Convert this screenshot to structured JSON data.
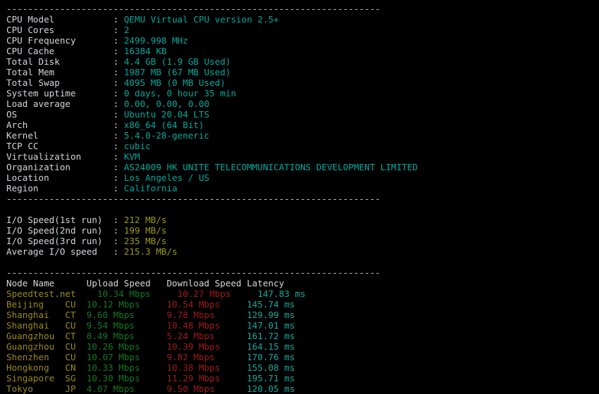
{
  "terminal": {
    "separator": "----------------------------------------------------------------------",
    "colors": {
      "background": "#000000",
      "label": "#d4d7da",
      "value_cyan": "#00a99d",
      "value_yellow": "#9a9a1f",
      "node_name": "#9a8a12",
      "upload": "#117a23",
      "download": "#a11a1a",
      "latency": "#14a89a",
      "separator": "#c9cdd1"
    }
  },
  "system_info": {
    "rows": [
      {
        "label": "CPU Model",
        "value": "QEMU Virtual CPU version 2.5+"
      },
      {
        "label": "CPU Cores",
        "value": "2"
      },
      {
        "label": "CPU Frequency",
        "value": "2499.998 MHz"
      },
      {
        "label": "CPU Cache",
        "value": "16384 KB"
      },
      {
        "label": "Total Disk",
        "value": "4.4 GB (1.9 GB Used)"
      },
      {
        "label": "Total Mem",
        "value": "1987 MB (67 MB Used)"
      },
      {
        "label": "Total Swap",
        "value": "4095 MB (0 MB Used)"
      },
      {
        "label": "System uptime",
        "value": "0 days, 0 hour 35 min"
      },
      {
        "label": "Load average",
        "value": "0.00, 0.00, 0.00"
      },
      {
        "label": "OS",
        "value": "Ubuntu 20.04 LTS"
      },
      {
        "label": "Arch",
        "value": "x86_64 (64 Bit)"
      },
      {
        "label": "Kernel",
        "value": "5.4.0-28-generic"
      },
      {
        "label": "TCP CC",
        "value": "cubic"
      },
      {
        "label": "Virtualization",
        "value": "KVM"
      },
      {
        "label": "Organization",
        "value": "AS24009 HK UNITE TELECOMMUNICATIONS DEVELOPMENT LIMITED"
      },
      {
        "label": "Location",
        "value": "Los Angeles / US"
      },
      {
        "label": "Region",
        "value": "California"
      }
    ]
  },
  "io_speed": {
    "rows": [
      {
        "label": "I/O Speed(1st run)",
        "value": "212 MB/s"
      },
      {
        "label": "I/O Speed(2nd run)",
        "value": "199 MB/s"
      },
      {
        "label": "I/O Speed(3rd run)",
        "value": "235 MB/s"
      },
      {
        "label": "Average I/O speed",
        "value": "215.3 MB/s"
      }
    ]
  },
  "speedtest": {
    "headers": {
      "node_name": "Node Name",
      "upload": "Upload Speed",
      "download": "Download Speed",
      "latency": "Latency"
    },
    "rows": [
      {
        "node": "Speedtest.net",
        "isp": "",
        "upload": "10.34 Mbps",
        "download": "10.27 Mbps",
        "latency": "147.83 ms"
      },
      {
        "node": "Beijing",
        "isp": "CU",
        "upload": "10.12 Mbps",
        "download": "10.54 Mbps",
        "latency": "145.74 ms"
      },
      {
        "node": "Shanghai",
        "isp": "CT",
        "upload": "9.60 Mbps",
        "download": "9.78 Mbps",
        "latency": "129.99 ms"
      },
      {
        "node": "Shanghai",
        "isp": "CU",
        "upload": "9.54 Mbps",
        "download": "10.48 Mbps",
        "latency": "147.01 ms"
      },
      {
        "node": "Guangzhou",
        "isp": "CT",
        "upload": "8.49 Mbps",
        "download": "5.24 Mbps",
        "latency": "161.72 ms"
      },
      {
        "node": "Guangzhou",
        "isp": "CU",
        "upload": "10.26 Mbps",
        "download": "10.39 Mbps",
        "latency": "164.15 ms"
      },
      {
        "node": "Shenzhen",
        "isp": "CU",
        "upload": "10.07 Mbps",
        "download": "9.82 Mbps",
        "latency": "170.76 ms"
      },
      {
        "node": "Hongkong",
        "isp": "CN",
        "upload": "10.33 Mbps",
        "download": "10.38 Mbps",
        "latency": "155.08 ms"
      },
      {
        "node": "Singapore",
        "isp": "SG",
        "upload": "10.30 Mbps",
        "download": "11.29 Mbps",
        "latency": "195.71 ms"
      },
      {
        "node": "Tokyo",
        "isp": "JP",
        "upload": "4.07 Mbps",
        "download": "9.50 Mbps",
        "latency": "120.05 ms"
      }
    ]
  }
}
